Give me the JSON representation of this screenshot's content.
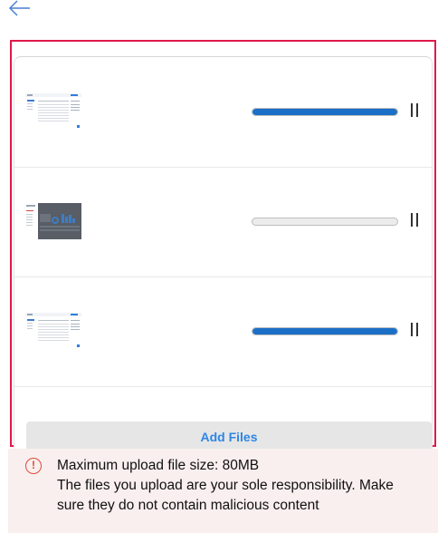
{
  "header": {
    "back_icon": "arrow-left-icon"
  },
  "files": [
    {
      "thumbnail": "table-screenshot",
      "progress": 1.0,
      "control": "pause"
    },
    {
      "thumbnail": "dashboard-screenshot",
      "progress": 0.0,
      "control": "pause"
    },
    {
      "thumbnail": "table-screenshot",
      "progress": 1.0,
      "control": "pause"
    }
  ],
  "actions": {
    "add_files_label": "Add Files"
  },
  "notice": {
    "icon": "exclamation-circle-icon",
    "glyph": "!",
    "max_size": "Maximum upload file size: 80MB",
    "responsibility": "The files you upload are your sole responsibility. Make sure they do not contain malicious content"
  },
  "colors": {
    "accent": "#1c6fc7",
    "link": "#2d86e6",
    "highlight_border": "#e0194a",
    "warning": "#e04a3a"
  }
}
